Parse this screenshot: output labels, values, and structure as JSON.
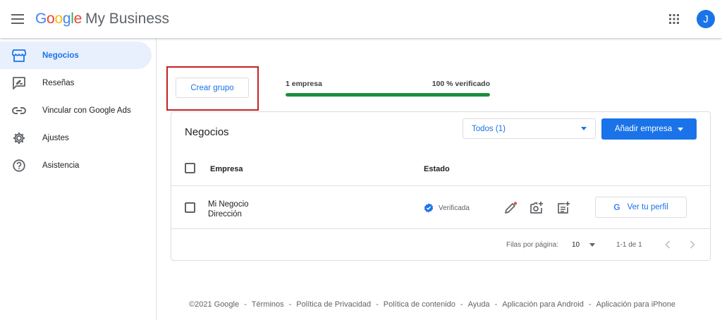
{
  "header": {
    "logo_google": [
      "G",
      "o",
      "o",
      "g",
      "l",
      "e"
    ],
    "logo_colors": [
      "#4285F4",
      "#EA4335",
      "#FBBC05",
      "#4285F4",
      "#34A853",
      "#EA4335"
    ],
    "product": "My Business",
    "avatar_initial": "J",
    "menu_icon": "hamburger-menu-icon",
    "apps_icon": "apps-grid-icon"
  },
  "sidebar": {
    "items": [
      {
        "label": "Negocios",
        "icon": "storefront-icon",
        "active": true
      },
      {
        "label": "Reseñas",
        "icon": "review-icon",
        "active": false
      },
      {
        "label": "Vincular con Google Ads",
        "icon": "link-icon",
        "active": false
      },
      {
        "label": "Ajustes",
        "icon": "gear-icon",
        "active": false
      },
      {
        "label": "Asistencia",
        "icon": "help-icon",
        "active": false
      }
    ]
  },
  "top": {
    "create_group_label": "Crear grupo",
    "progress_left": "1 empresa",
    "progress_right": "100 % verificado",
    "progress_fraction": 1.0
  },
  "card": {
    "title": "Negocios",
    "filter_value": "Todos (1)",
    "add_button_label": "Añadir empresa",
    "columns": {
      "empresa": "Empresa",
      "estado": "Estado"
    },
    "rows": [
      {
        "name": "Mi Negocio",
        "address": "Dirección",
        "status": "Verificada",
        "profile_label": "Ver tu perfil",
        "profile_g": "G"
      }
    ],
    "pagination": {
      "rows_per_page_label": "Filas por página:",
      "rows_per_page": "10",
      "range": "1-1 de 1"
    }
  },
  "footer": {
    "links": [
      "©2021 Google",
      "Términos",
      "Política de Privacidad",
      "Política de contenido",
      "Ayuda",
      "Aplicación para Android",
      "Aplicación para iPhone"
    ],
    "separator": "-"
  },
  "colors": {
    "accent": "#1a73e8",
    "progress": "#1e8e3e",
    "highlight": "#c5221f",
    "active_bg": "#e8f0fe"
  }
}
